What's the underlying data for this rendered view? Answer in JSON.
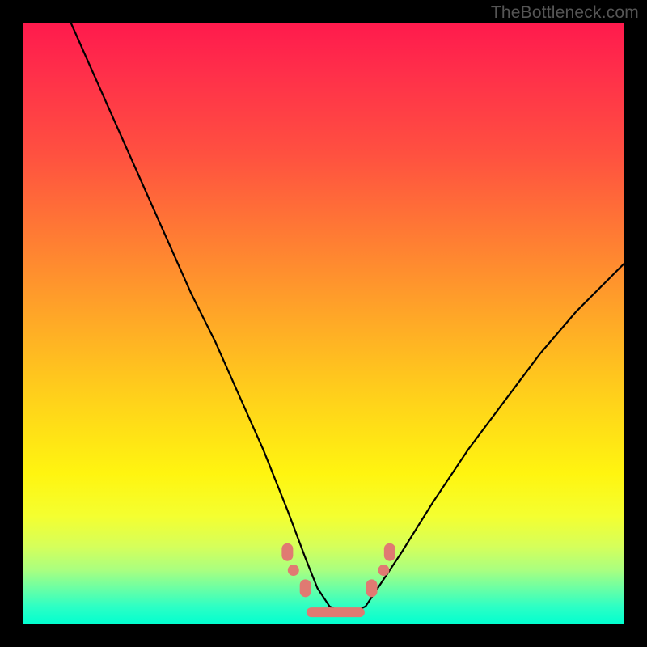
{
  "watermark": "TheBottleneck.com",
  "chart_data": {
    "type": "line",
    "title": "",
    "xlabel": "",
    "ylabel": "",
    "xlim": [
      0,
      100
    ],
    "ylim": [
      0,
      100
    ],
    "grid": false,
    "legend": false,
    "series": [
      {
        "name": "bottleneck-curve",
        "color": "#000000",
        "x": [
          8,
          12,
          16,
          20,
          24,
          28,
          32,
          36,
          40,
          44,
          47,
          49,
          51,
          53,
          55,
          57,
          59,
          63,
          68,
          74,
          80,
          86,
          92,
          98,
          100
        ],
        "y": [
          100,
          91,
          82,
          73,
          64,
          55,
          47,
          38,
          29,
          19,
          11,
          6,
          3,
          2,
          2,
          3,
          6,
          12,
          20,
          29,
          37,
          45,
          52,
          58,
          60
        ]
      }
    ],
    "markers": [
      {
        "name": "left-marker-1",
        "x": 44,
        "y": 12,
        "shape": "pill",
        "color": "#e07a72"
      },
      {
        "name": "left-marker-2",
        "x": 45,
        "y": 9,
        "shape": "dot",
        "color": "#e07a72"
      },
      {
        "name": "left-marker-3",
        "x": 47,
        "y": 6,
        "shape": "pill",
        "color": "#e07a72"
      },
      {
        "name": "floor-dash",
        "x": 52,
        "y": 2,
        "shape": "bar",
        "color": "#e07a72"
      },
      {
        "name": "right-marker-1",
        "x": 58,
        "y": 6,
        "shape": "pill",
        "color": "#e07a72"
      },
      {
        "name": "right-marker-2",
        "x": 60,
        "y": 9,
        "shape": "dot",
        "color": "#e07a72"
      },
      {
        "name": "right-marker-3",
        "x": 61,
        "y": 12,
        "shape": "pill",
        "color": "#e07a72"
      }
    ]
  }
}
